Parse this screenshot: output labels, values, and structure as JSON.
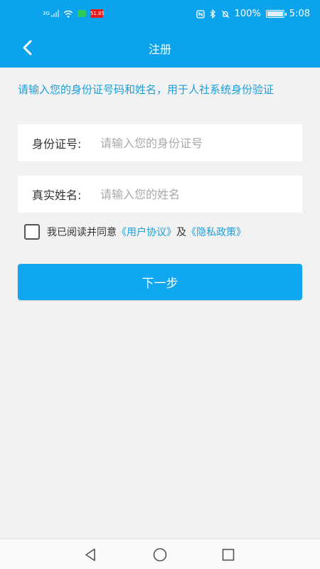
{
  "status_bar": {
    "network_label": "3G",
    "app_badge": "51.85",
    "battery_text": "100%",
    "battery_level": 1.0,
    "time": "5:08"
  },
  "header": {
    "title": "注册",
    "bg_color": "#0ba3ec"
  },
  "form": {
    "intro": "请输入您的身份证号码和姓名，用于人社系统身份验证",
    "id_label": "身份证号:",
    "id_placeholder": "请输入您的身份证号",
    "id_value": "",
    "name_label": "真实姓名:",
    "name_placeholder": "请输入您的姓名",
    "name_value": ""
  },
  "agreement": {
    "checked": false,
    "prefix": "我已阅读并同意",
    "user_agreement": "《用户协议》",
    "joiner": "及",
    "privacy_policy": "《隐私政策》"
  },
  "next_button": {
    "label": "下一步",
    "color": "#0fa7ef"
  },
  "navbar": {
    "icons": [
      "back-triangle-icon",
      "home-circle-icon",
      "recents-square-icon"
    ]
  }
}
